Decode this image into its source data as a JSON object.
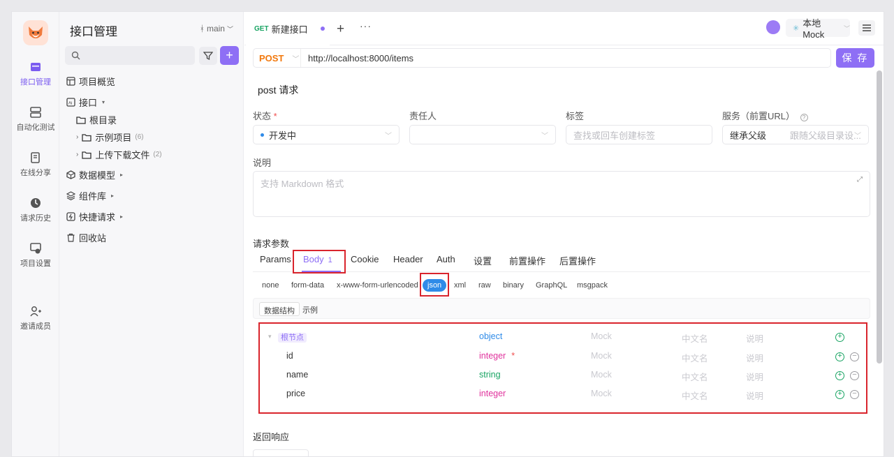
{
  "rail": {
    "items": [
      {
        "label": "接口管理",
        "icon": "api-icon",
        "active": true
      },
      {
        "label": "自动化测试",
        "icon": "stack-icon"
      },
      {
        "label": "在线分享",
        "icon": "share-doc-icon"
      },
      {
        "label": "请求历史",
        "icon": "history-icon"
      },
      {
        "label": "项目设置",
        "icon": "settings-icon"
      },
      {
        "label": "邀请成员",
        "icon": "add-user-icon"
      }
    ]
  },
  "sidebar": {
    "title": "接口管理",
    "branch": "main",
    "tree": [
      {
        "label": "项目概览",
        "icon": "overview-icon"
      },
      {
        "label": "接口",
        "icon": "api-box-icon",
        "caret": "▾"
      },
      {
        "label": "根目录",
        "icon": "folder-icon"
      },
      {
        "label": "示例项目",
        "icon": "folder-icon",
        "count": "(6)"
      },
      {
        "label": "上传下载文件",
        "icon": "folder-icon",
        "count": "(2)"
      },
      {
        "label": "数据模型",
        "icon": "cube-icon",
        "caret": "▸"
      },
      {
        "label": "组件库",
        "icon": "layers-icon",
        "caret": "▸"
      },
      {
        "label": "快捷请求",
        "icon": "bolt-icon",
        "caret": "▸"
      },
      {
        "label": "回收站",
        "icon": "trash-icon"
      }
    ]
  },
  "tabbar": {
    "tab_method": "GET",
    "tab_title": "新建接口",
    "plus": "+",
    "more": "···",
    "env_label": "本地 Mock",
    "env_star": "✳"
  },
  "request": {
    "method": "POST",
    "url": "http://localhost:8000/items",
    "save_label": "保 存",
    "name": "post 请求"
  },
  "fields": {
    "status_label": "状态",
    "status_required": "*",
    "status_value": "开发中",
    "owner_label": "责任人",
    "tags_label": "标签",
    "tags_placeholder": "查找或回车创建标签",
    "service_label": "服务（前置URL）",
    "service_value": "继承父级",
    "service_placeholder": "跟随父级目录设...",
    "desc_label": "说明",
    "desc_placeholder": "支持 Markdown 格式"
  },
  "params": {
    "label": "请求参数",
    "tabs": [
      {
        "label": "Params"
      },
      {
        "label": "Body",
        "count": "1",
        "active": true
      },
      {
        "label": "Cookie"
      },
      {
        "label": "Header"
      },
      {
        "label": "Auth"
      },
      {
        "label": "设置"
      },
      {
        "label": "前置操作"
      },
      {
        "label": "后置操作"
      }
    ],
    "body_types": [
      "none",
      "form-data",
      "x-www-form-urlencoded",
      "json",
      "xml",
      "raw",
      "binary",
      "GraphQL",
      "msgpack"
    ],
    "active_body_type": "json",
    "segments": [
      "数据结构",
      "示例"
    ]
  },
  "schema": {
    "placeholders": {
      "mock": "Mock",
      "cn_name": "中文名",
      "desc": "说明"
    },
    "rows": [
      {
        "field": "根节点",
        "type": "object",
        "root": true
      },
      {
        "field": "id",
        "type": "integer",
        "required": "*"
      },
      {
        "field": "name",
        "type": "string"
      },
      {
        "field": "price",
        "type": "integer"
      }
    ]
  },
  "response": {
    "label": "返回响应"
  },
  "colors": {
    "accent": "#8e6ff5",
    "post": "#f2780c",
    "highlight": "#d9242c",
    "object": "#2f8be8",
    "integer": "#e0339d",
    "string": "#19a463"
  }
}
